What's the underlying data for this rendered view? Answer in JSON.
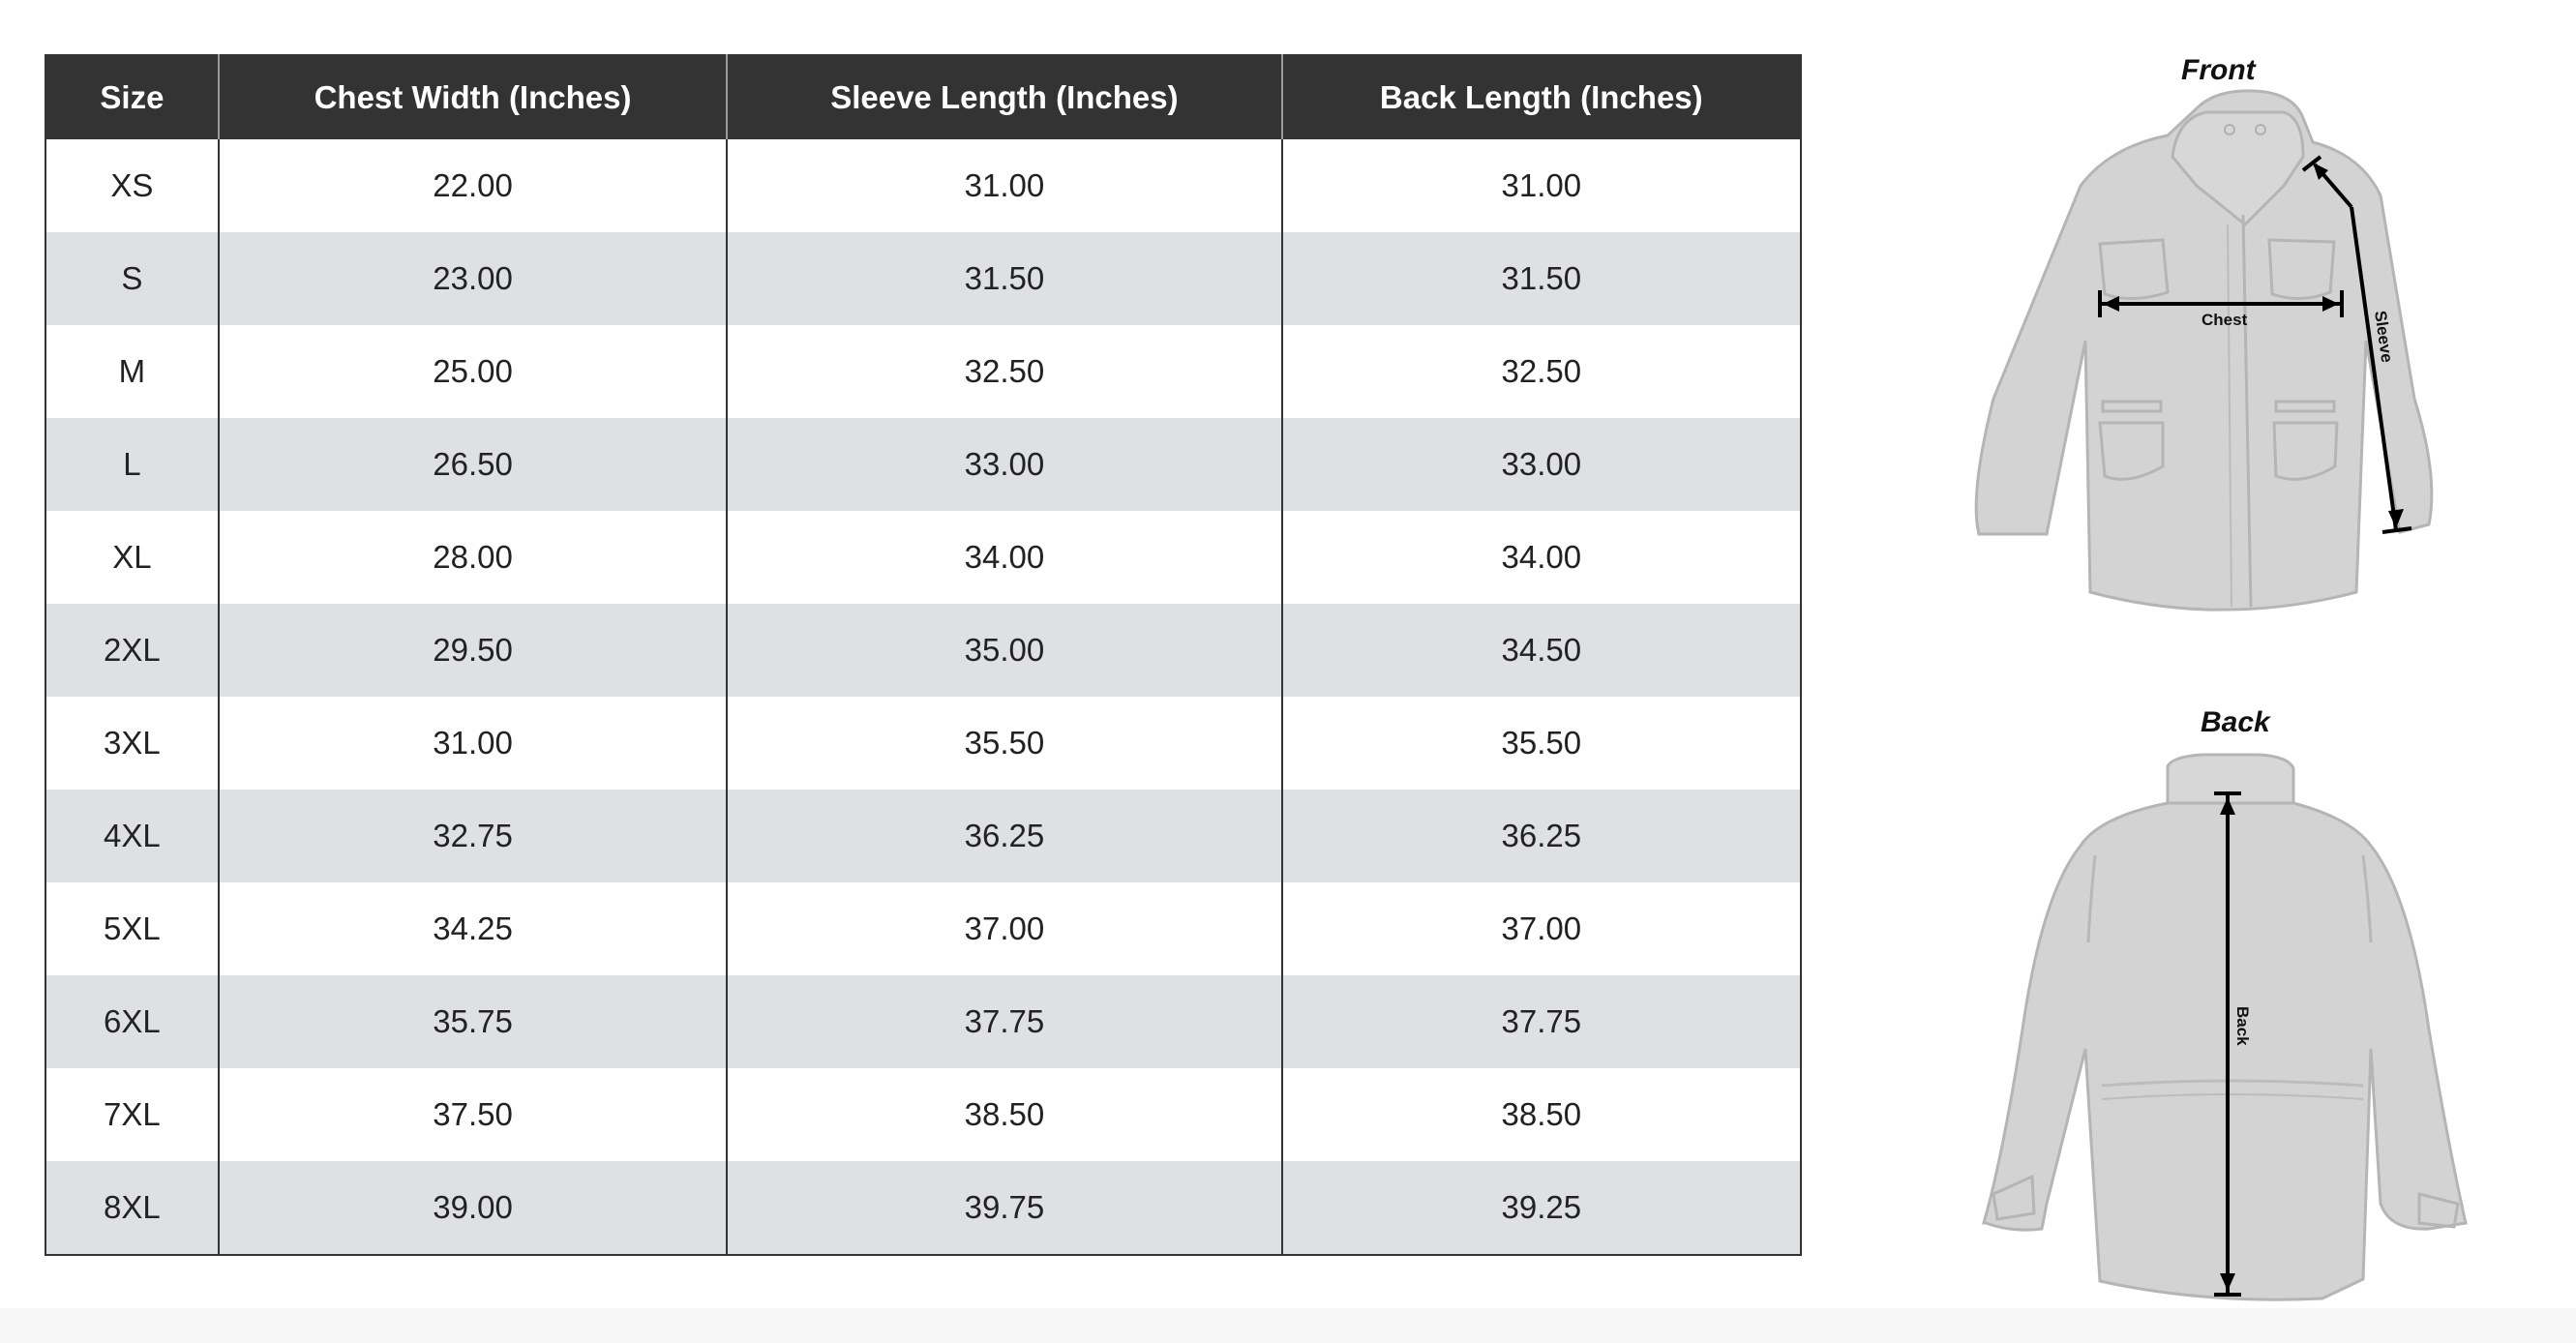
{
  "table": {
    "headers": [
      "Size",
      "Chest Width (Inches)",
      "Sleeve Length (Inches)",
      "Back Length (Inches)"
    ],
    "rows": [
      {
        "size": "XS",
        "chest": "22.00",
        "sleeve": "31.00",
        "back": "31.00"
      },
      {
        "size": "S",
        "chest": "23.00",
        "sleeve": "31.50",
        "back": "31.50"
      },
      {
        "size": "M",
        "chest": "25.00",
        "sleeve": "32.50",
        "back": "32.50"
      },
      {
        "size": "L",
        "chest": "26.50",
        "sleeve": "33.00",
        "back": "33.00"
      },
      {
        "size": "XL",
        "chest": "28.00",
        "sleeve": "34.00",
        "back": "34.00"
      },
      {
        "size": "2XL",
        "chest": "29.50",
        "sleeve": "35.00",
        "back": "34.50"
      },
      {
        "size": "3XL",
        "chest": "31.00",
        "sleeve": "35.50",
        "back": "35.50"
      },
      {
        "size": "4XL",
        "chest": "32.75",
        "sleeve": "36.25",
        "back": "36.25"
      },
      {
        "size": "5XL",
        "chest": "34.25",
        "sleeve": "37.00",
        "back": "37.00"
      },
      {
        "size": "6XL",
        "chest": "35.75",
        "sleeve": "37.75",
        "back": "37.75"
      },
      {
        "size": "7XL",
        "chest": "37.50",
        "sleeve": "38.50",
        "back": "38.50"
      },
      {
        "size": "8XL",
        "chest": "39.00",
        "sleeve": "39.75",
        "back": "39.25"
      }
    ]
  },
  "diagrams": {
    "front": {
      "title": "Front",
      "chest_label": "Chest",
      "sleeve_label": "Sleeve"
    },
    "back": {
      "title": "Back",
      "back_label": "Back"
    }
  },
  "colors": {
    "header_bg": "#333333",
    "header_text": "#ffffff",
    "stripe": "#dfe0e2",
    "garment": "#d3d3d3",
    "garment_outline": "#b5b5b5"
  }
}
